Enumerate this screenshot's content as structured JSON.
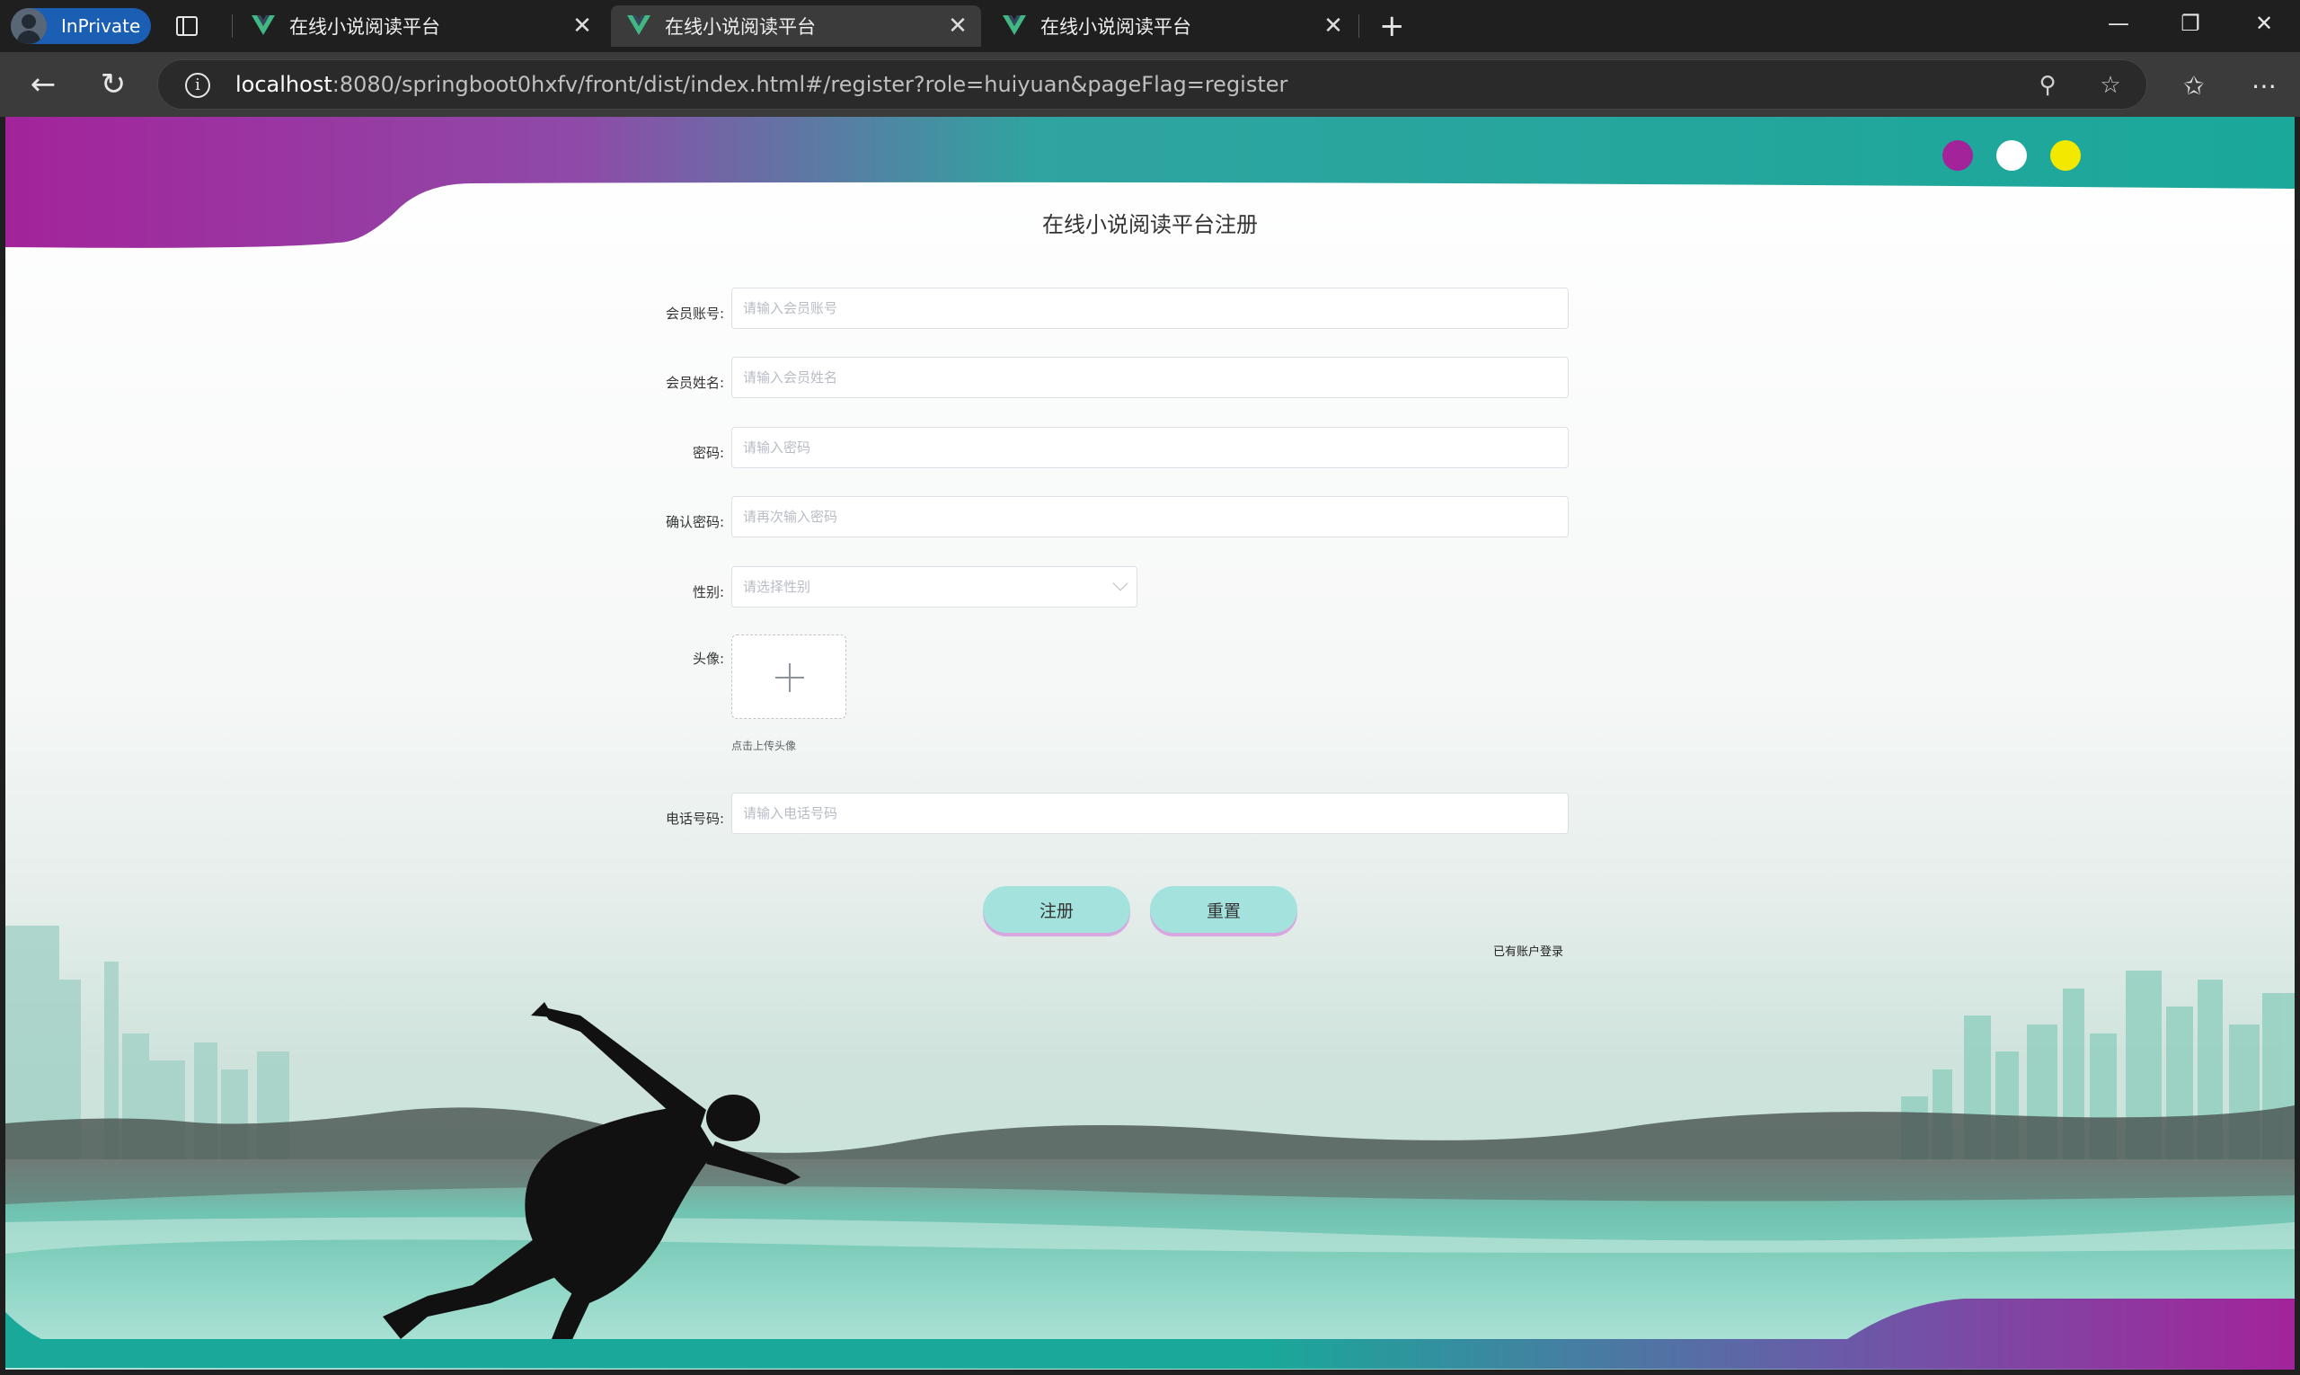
{
  "browser": {
    "inprivate_label": "InPrivate",
    "tabs": [
      {
        "title": "在线小说阅读平台",
        "active": false
      },
      {
        "title": "在线小说阅读平台",
        "active": true
      },
      {
        "title": "在线小说阅读平台",
        "active": false
      }
    ],
    "url_host": "localhost",
    "url_rest": ":8080/springboot0hxfv/front/dist/index.html#/register?role=huiyuan&pageFlag=register"
  },
  "page": {
    "title": "在线小说阅读平台注册",
    "fields": [
      {
        "label": "会员账号:",
        "placeholder": "请输入会员账号",
        "value": ""
      },
      {
        "label": "会员姓名:",
        "placeholder": "请输入会员姓名",
        "value": ""
      },
      {
        "label": "密码:",
        "placeholder": "请输入密码",
        "value": ""
      },
      {
        "label": "确认密码:",
        "placeholder": "请再次输入密码",
        "value": ""
      },
      {
        "label": "性别:",
        "placeholder": "请选择性别",
        "value": ""
      },
      {
        "label": "头像:"
      },
      {
        "label": "电话号码:",
        "placeholder": "请输入电话号码",
        "value": ""
      }
    ],
    "upload_tip": "点击上传头像",
    "register_button": "注册",
    "reset_button": "重置",
    "login_link": "已有账户登录",
    "dot_colors": [
      "#a3239b",
      "#ffffff",
      "#f2e800"
    ],
    "accent_colors": {
      "purple": "#a3239b",
      "teal": "#1aa89a",
      "button": "#a4e3dd"
    }
  }
}
